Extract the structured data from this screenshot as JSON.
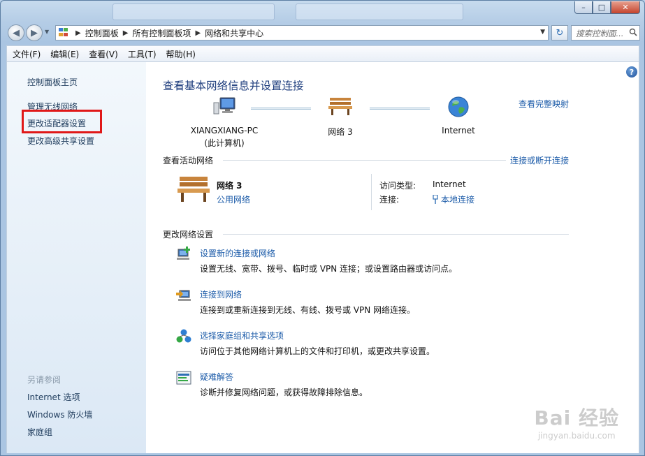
{
  "window": {
    "caption_minimize": "–",
    "caption_maximize": "□",
    "caption_close": "✕"
  },
  "address": {
    "crumbs": [
      "控制面板",
      "所有控制面板项",
      "网络和共享中心"
    ],
    "search_placeholder": "搜索控制面..."
  },
  "menu": [
    "文件(F)",
    "编辑(E)",
    "查看(V)",
    "工具(T)",
    "帮助(H)"
  ],
  "sidebar": {
    "items": [
      "控制面板主页",
      "管理无线网络",
      "更改适配器设置",
      "更改高级共享设置"
    ],
    "see_also_title": "另请参阅",
    "see_also": [
      "Internet 选项",
      "Windows 防火墙",
      "家庭组"
    ]
  },
  "main": {
    "title": "查看基本网络信息并设置连接",
    "full_map_link": "查看完整映射",
    "map": {
      "computer_name": "XIANGXIANG-PC",
      "computer_sub": "(此计算机)",
      "network_name": "网络  3",
      "internet": "Internet"
    },
    "active_section": "查看活动网络",
    "connect_link": "连接或断开连接",
    "active_network": {
      "name": "网络  3",
      "type": "公用网络",
      "access_label": "访问类型:",
      "access_value": "Internet",
      "connection_label": "连接:",
      "connection_value": "本地连接"
    },
    "change_section": "更改网络设置",
    "tasks": [
      {
        "title": "设置新的连接或网络",
        "desc": "设置无线、宽带、拨号、临时或 VPN 连接；或设置路由器或访问点。"
      },
      {
        "title": "连接到网络",
        "desc": "连接到或重新连接到无线、有线、拨号或 VPN 网络连接。"
      },
      {
        "title": "选择家庭组和共享选项",
        "desc": "访问位于其他网络计算机上的文件和打印机，或更改共享设置。"
      },
      {
        "title": "疑难解答",
        "desc": "诊断并修复网络问题，或获得故障排除信息。"
      }
    ]
  },
  "watermark": {
    "main": "Bai 经验",
    "sub": "jingyan.baidu.com"
  }
}
